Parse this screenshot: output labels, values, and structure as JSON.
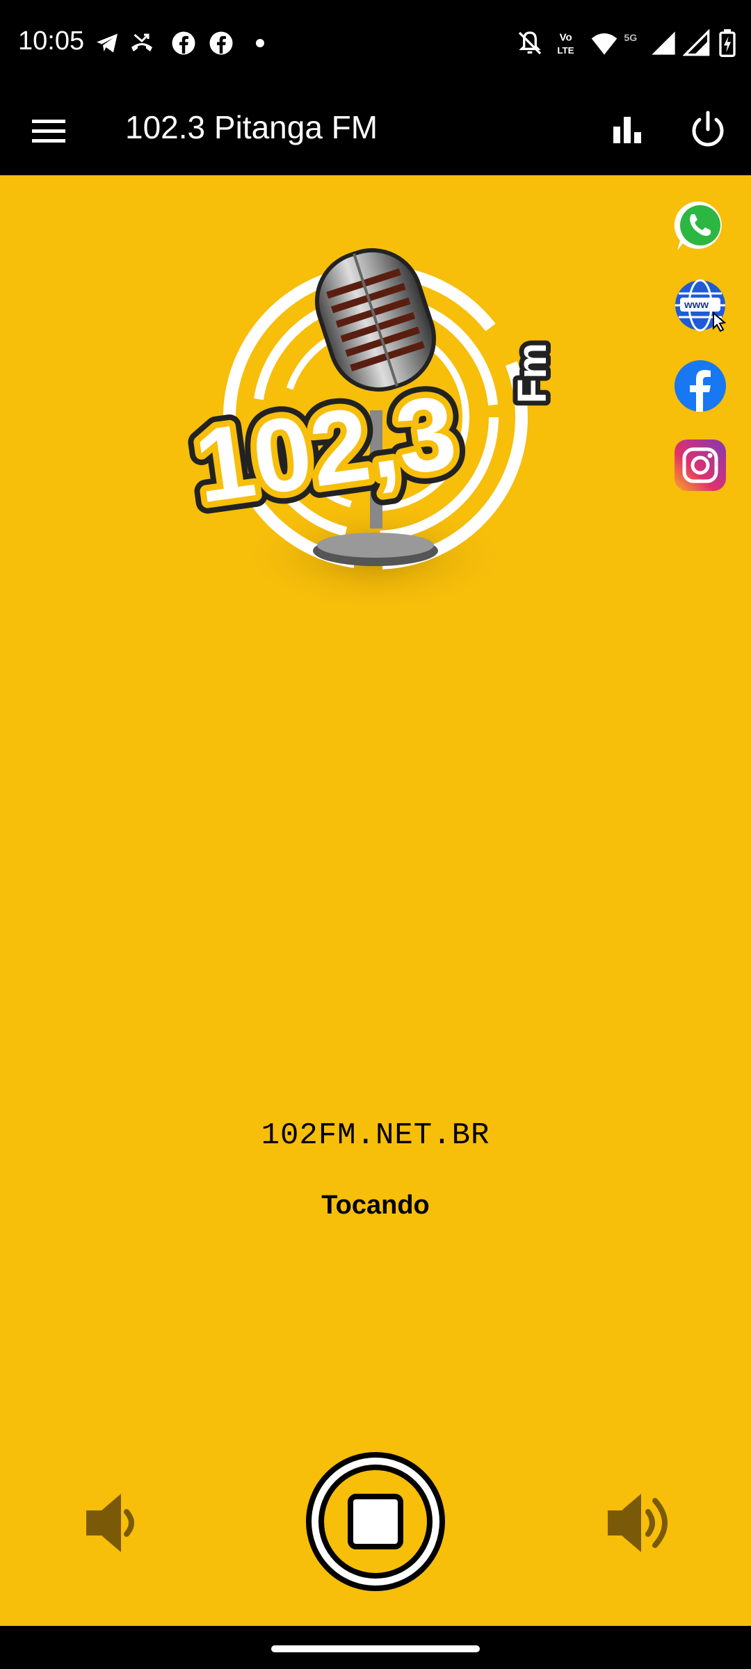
{
  "status_bar": {
    "time": "10:05",
    "notification_icons": [
      "telegram-icon",
      "missed-call-icon",
      "facebook-icon",
      "facebook-icon",
      "dot-icon"
    ],
    "right_icons": [
      "bell-off-icon",
      "volte-icon",
      "wifi-icon",
      "5g-signal-icon",
      "signal-icon",
      "battery-icon"
    ],
    "network_label": "5G",
    "volte_label_top": "Vo",
    "volte_label_bottom": "LTE"
  },
  "app_bar": {
    "title": "102.3 Pitanga FM"
  },
  "logo": {
    "number": "102,3",
    "suffix": "Fm"
  },
  "social_links": [
    "whatsapp-icon",
    "website-icon",
    "facebook-icon",
    "instagram-icon"
  ],
  "social_website_label": "www",
  "player": {
    "site_url": "102FM.NET.BR",
    "status": "Tocando"
  },
  "colors": {
    "background": "#f7be0a",
    "bar": "#000000",
    "volume_icon": "#7a5a08"
  }
}
